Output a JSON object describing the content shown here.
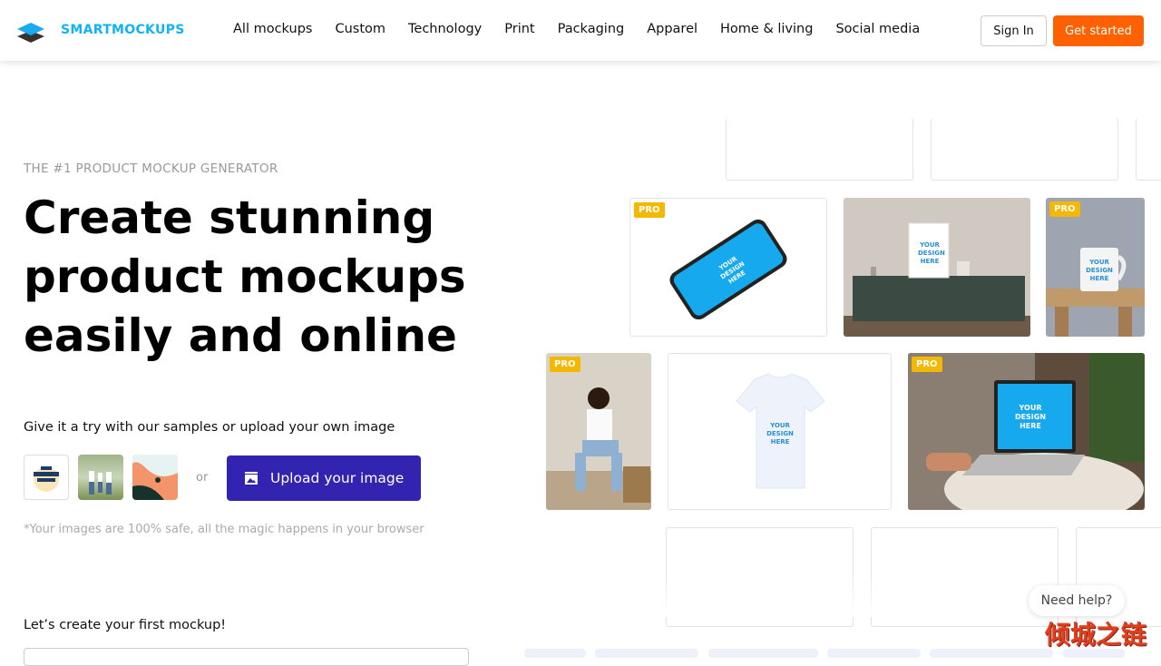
{
  "nav": {
    "brand": "SMARTMOCKUPS",
    "items": [
      "All mockups",
      "Custom",
      "Technology",
      "Print",
      "Packaging",
      "Apparel",
      "Home & living",
      "Social media"
    ],
    "sign_in": "Sign In",
    "get_started": "Get started"
  },
  "hero": {
    "eyebrow": "THE #1 PRODUCT MOCKUP GENERATOR",
    "title": "Create stunning product mockups easily and online",
    "try_text": "Give it a try with our samples or upload your own image",
    "or": "or",
    "upload_label": "Upload your image",
    "safe_note": "*Your images are 100% safe, all the magic happens in your browser",
    "first_mockup": "Let’s create your first mockup!"
  },
  "tiles": {
    "pro_label": "PRO",
    "design_text": "YOUR DESIGN HERE"
  },
  "help": "Need help?",
  "watermark": "倾城之链",
  "colors": {
    "brand": "#10b4f4",
    "cta": "#ff6000",
    "upload": "#3223b0",
    "pro": "#f5b800"
  }
}
